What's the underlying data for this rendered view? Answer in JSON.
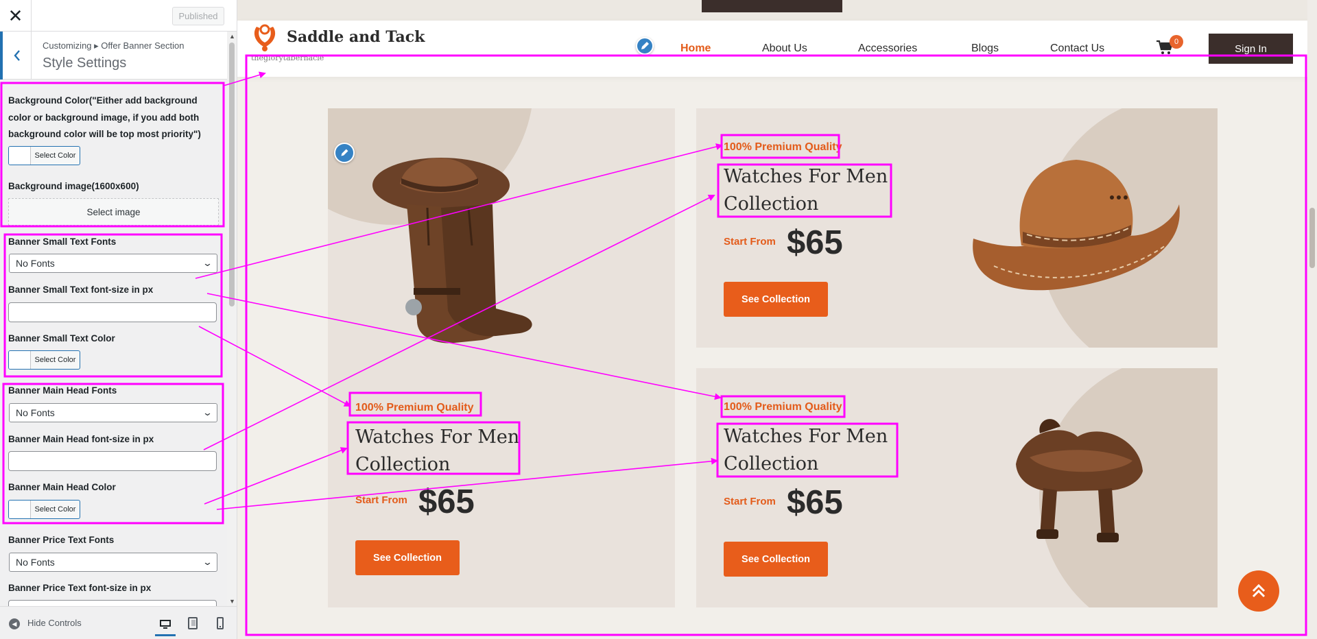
{
  "customizer": {
    "close_symbol": "✕",
    "published_label": "Published",
    "breadcrumb": "Customizing ▸ Offer Banner Section",
    "section_title": "Style Settings",
    "fields": {
      "bg_color_label": "Background Color(\"Either add background color or background image, if you add both background color will be top most priority\")",
      "bg_image_label": "Background image(1600x600)",
      "small_fonts_label": "Banner Small Text Fonts",
      "small_size_label": "Banner Small Text font-size in px",
      "small_color_label": "Banner Small Text Color",
      "main_fonts_label": "Banner Main Head Fonts",
      "main_size_label": "Banner Main Head font-size in px",
      "main_color_label": "Banner Main Head Color",
      "price_fonts_label": "Banner Price Text Fonts",
      "price_size_label": "Banner Price Text font-size in px"
    },
    "select_color_label": "Select Color",
    "select_image_label": "Select image",
    "font_option": "No Fonts",
    "hide_controls_label": "Hide Controls"
  },
  "site": {
    "name": "Saddle and Tack",
    "tagline": "theglorytabernacle",
    "nav": [
      "Home",
      "About Us",
      "Accessories",
      "Blogs",
      "Contact Us"
    ],
    "cart_count": "0",
    "signin_label": "Sign In"
  },
  "banners": [
    {
      "small": "100% Premium Quality",
      "head": "Watches For Men Collection",
      "start": "Start From",
      "price": "$65",
      "button": "See Collection"
    },
    {
      "small": "100% Premium Quality",
      "head": "Watches For Men Collection",
      "start": "Start From",
      "price": "$65",
      "button": "See Collection"
    },
    {
      "small": "100% Premium Quality",
      "head": "Watches For Men Collection",
      "start": "Start From",
      "price": "$65",
      "button": "See Collection"
    }
  ],
  "colors": {
    "accent": "#e85d1b",
    "dark": "#3b2e2b",
    "card_bg": "#e9e2dc",
    "annotation": "#ff00ff",
    "wp_blue": "#2271b1"
  },
  "icons": {
    "close": "close-icon",
    "back": "chevron-left-icon",
    "edit": "pencil-icon",
    "cart": "cart-icon",
    "scroll_top": "double-chevron-up-icon",
    "desktop": "desktop-icon",
    "tablet": "tablet-icon",
    "mobile": "mobile-icon"
  }
}
